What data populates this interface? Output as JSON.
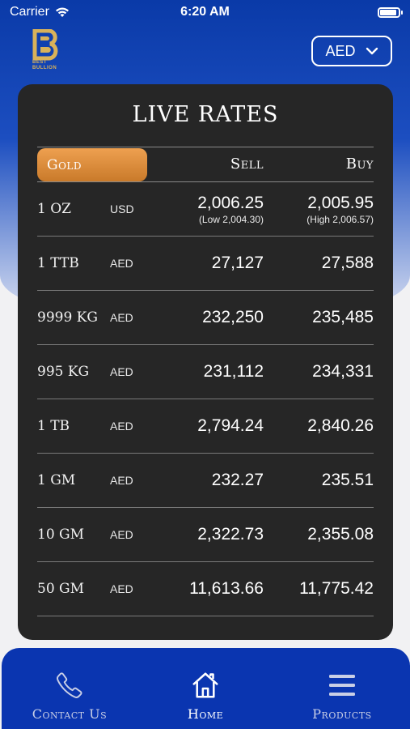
{
  "status": {
    "carrier": "Carrier",
    "time": "6:20 AM"
  },
  "brand": {
    "line1": "BEST",
    "line2": "BULLION"
  },
  "currency": {
    "selected": "AED"
  },
  "rates": {
    "title": "LIVE RATES",
    "tab": "Gold",
    "sell_header": "Sell",
    "buy_header": "Buy",
    "rows": [
      {
        "name": "1 OZ",
        "currency": "USD",
        "sell": "2,006.25",
        "buy": "2,005.95",
        "sell_note": "(Low 2,004.30)",
        "buy_note": "(High 2,006.57)"
      },
      {
        "name": "1 TTB",
        "currency": "AED",
        "sell": "27,127",
        "buy": "27,588"
      },
      {
        "name": "9999 KG",
        "currency": "AED",
        "sell": "232,250",
        "buy": "235,485"
      },
      {
        "name": "995 KG",
        "currency": "AED",
        "sell": "231,112",
        "buy": "234,331"
      },
      {
        "name": "1 TB",
        "currency": "AED",
        "sell": "2,794.24",
        "buy": "2,840.26"
      },
      {
        "name": "1 GM",
        "currency": "AED",
        "sell": "232.27",
        "buy": "235.51"
      },
      {
        "name": "10 GM",
        "currency": "AED",
        "sell": "2,322.73",
        "buy": "2,355.08"
      },
      {
        "name": "50 GM",
        "currency": "AED",
        "sell": "11,613.66",
        "buy": "11,775.42"
      }
    ]
  },
  "nav": {
    "contact": "Contact Us",
    "home": "Home",
    "products": "Products",
    "active": "home"
  },
  "colors": {
    "brand_blue": "#0a35b0",
    "gold_tab": "#e39442",
    "panel": "#262626"
  }
}
